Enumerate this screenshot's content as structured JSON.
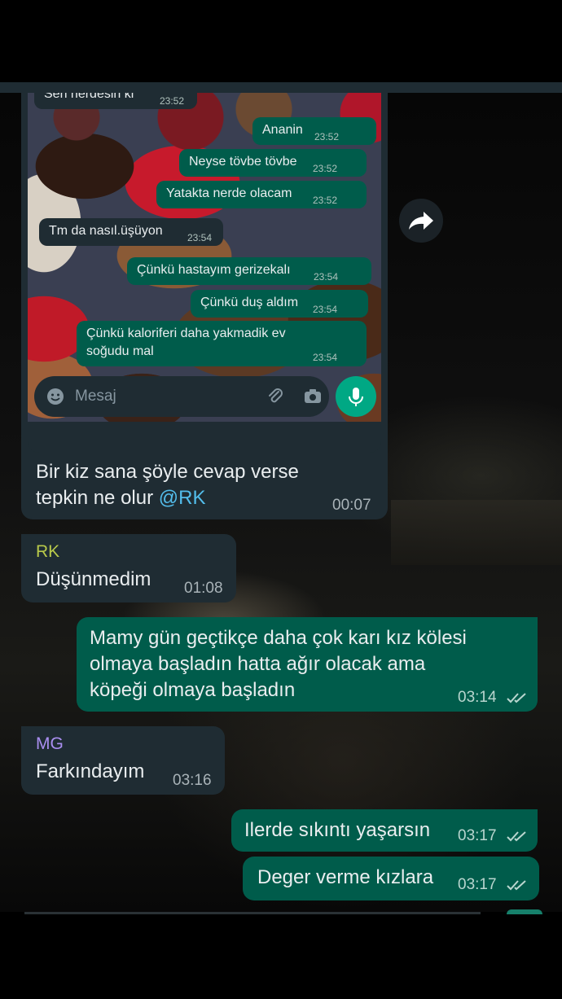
{
  "colors": {
    "incoming_bubble": "#1f2c33",
    "outgoing_bubble": "#005c4b",
    "mention": "#53bdeb",
    "sender_rk": "#b8c94a",
    "sender_mg": "#a98ef0"
  },
  "embedded_screenshot": {
    "messages": [
      {
        "direction": "in",
        "text": "Sen nerdesin ki",
        "time": "23:52"
      },
      {
        "direction": "out",
        "text": "Ananin",
        "time": "23:52"
      },
      {
        "direction": "out",
        "text": "Neyse tövbe tövbe",
        "time": "23:52"
      },
      {
        "direction": "out",
        "text": "Yatakta nerde olacam",
        "time": "23:52"
      },
      {
        "direction": "in",
        "text": "Tm da nasıl.üşüyon",
        "time": "23:54"
      },
      {
        "direction": "out",
        "text": "Çünkü hastayım gerizekalı",
        "time": "23:54"
      },
      {
        "direction": "out",
        "text": "Çünkü duş aldım",
        "time": "23:54"
      },
      {
        "direction": "out",
        "text_line1": "Çünkü kaloriferi daha yakmadik ev",
        "text_line2": "soğudu mal",
        "time": "23:54"
      }
    ],
    "input_placeholder": "Mesaj",
    "icons": [
      "emoji-icon",
      "attach-icon",
      "camera-icon",
      "mic-icon"
    ]
  },
  "messages": [
    {
      "direction": "in",
      "line1": "Bir kiz sana şöyle cevap verse",
      "line2_prefix": "tepkin ne olur ",
      "mention": "@RK",
      "time": "00:07"
    },
    {
      "direction": "in",
      "sender": "RK",
      "text": "Düşünmedim",
      "time": "01:08"
    },
    {
      "direction": "out",
      "line1": "Mamy gün geçtikçe daha çok karı kız kölesi",
      "line2": "olmaya başladın hatta ağır olacak ama",
      "line3": "köpeği olmaya başladın",
      "time": "03:14"
    },
    {
      "direction": "in",
      "sender": "MG",
      "text": "Farkındayım",
      "time": "03:16"
    },
    {
      "direction": "out",
      "text": "Ilerde sıkıntı yaşarsın",
      "time": "03:17"
    },
    {
      "direction": "out",
      "text": "Deger verme kızlara",
      "time": "03:17"
    }
  ]
}
